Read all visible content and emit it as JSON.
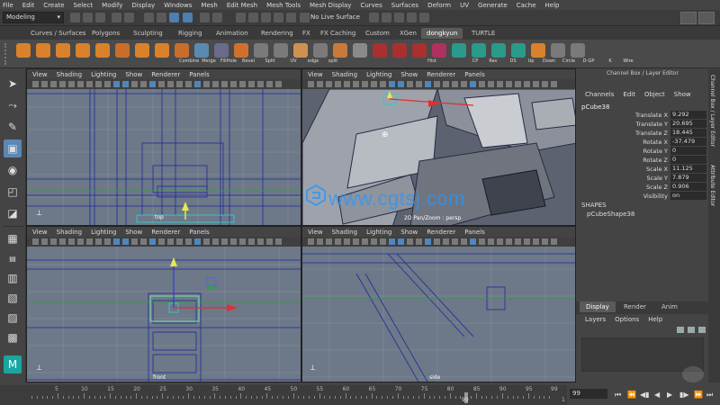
{
  "menubar": [
    "File",
    "Edit",
    "Create",
    "Select",
    "Modify",
    "Display",
    "Windows",
    "Mesh",
    "Edit Mesh",
    "Mesh Tools",
    "Mesh Display",
    "Curves",
    "Surfaces",
    "Deform",
    "UV",
    "Generate",
    "Cache",
    "Help"
  ],
  "status": {
    "mode": "Modeling",
    "live_surface": "No Live Surface"
  },
  "shelf_tabs": [
    "Curves / Surfaces",
    "Polygons",
    "Sculpting",
    "Rigging",
    "Animation",
    "Rendering",
    "FX",
    "FX Caching",
    "Custom",
    "XGen",
    "dongkyun",
    "TURTLE"
  ],
  "shelf_active": "dongkyun",
  "shelf_labels": [
    "Combine",
    "Merge",
    "FillHole",
    "Bevel",
    "Split",
    "UV",
    "edge",
    "split",
    "Hist",
    "CP",
    "Rev",
    "DS",
    "Up",
    "Down",
    "Circle",
    "D-GP",
    "K",
    "Wire"
  ],
  "viewport_menu": [
    "View",
    "Shading",
    "Lighting",
    "Show",
    "Renderer",
    "Panels"
  ],
  "viewports": {
    "top": "top",
    "persp": "2D Pan/Zoom : persp",
    "front": "front",
    "side": "side"
  },
  "channel_box": {
    "title": "Channel Box / Layer Editor",
    "menu": [
      "Channels",
      "Edit",
      "Object",
      "Show"
    ],
    "object": "pCube38",
    "attrs": [
      {
        "name": "Translate X",
        "value": "9.292"
      },
      {
        "name": "Translate Y",
        "value": "20.695"
      },
      {
        "name": "Translate Z",
        "value": "18.445"
      },
      {
        "name": "Rotate X",
        "value": "-37.479"
      },
      {
        "name": "Rotate Y",
        "value": "0"
      },
      {
        "name": "Rotate Z",
        "value": "0"
      },
      {
        "name": "Scale X",
        "value": "11.125"
      },
      {
        "name": "Scale Y",
        "value": "7.879"
      },
      {
        "name": "Scale Z",
        "value": "0.906"
      },
      {
        "name": "Visibility",
        "value": "on"
      }
    ],
    "shapes_label": "SHAPES",
    "shape_name": "pCubeShape38"
  },
  "layer_editor": {
    "tabs": [
      "Display",
      "Render",
      "Anim"
    ],
    "menu": [
      "Layers",
      "Options",
      "Help"
    ]
  },
  "side_tabs": [
    "Channel Box / Layer Editor",
    "Attribute Editor"
  ],
  "timeline": {
    "ticks": [
      "5",
      "10",
      "15",
      "20",
      "25",
      "30",
      "35",
      "40",
      "45",
      "50",
      "55",
      "60",
      "65",
      "70",
      "75",
      "80",
      "85",
      "90",
      "95"
    ],
    "current": "99",
    "end_label": "99",
    "frame_field": "99",
    "right_label": "1"
  },
  "watermark": "www.cgtsj.com",
  "colors": {
    "accent": "#5b87b5",
    "viewport_bg": "#6d7888",
    "wire": "#1e2a9a"
  }
}
